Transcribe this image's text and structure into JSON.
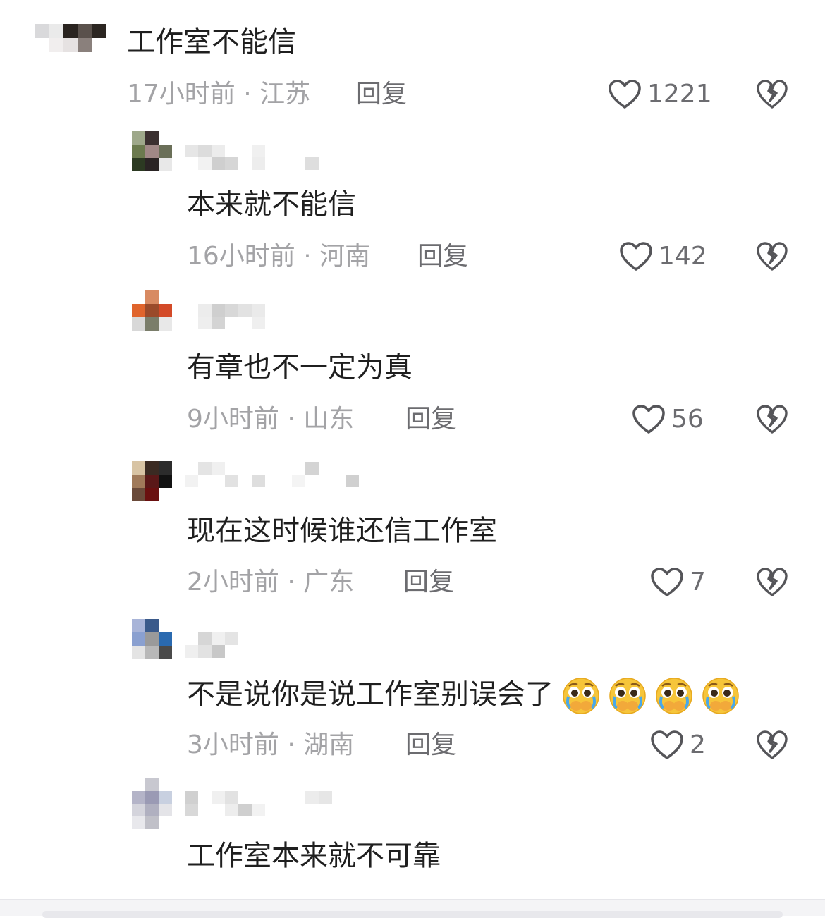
{
  "comments": [
    {
      "text": "工作室不能信",
      "time": "17小时前",
      "region": "江苏",
      "reply": "回复",
      "likes": "1221"
    },
    {
      "text": "本来就不能信",
      "time": "16小时前",
      "region": "河南",
      "reply": "回复",
      "likes": "142"
    },
    {
      "text": "有章也不一定为真",
      "time": "9小时前",
      "region": "山东",
      "reply": "回复",
      "likes": "56"
    },
    {
      "text": "现在这时候谁还信工作室",
      "time": "2小时前",
      "region": "广东",
      "reply": "回复",
      "likes": "7"
    },
    {
      "text": "不是说你是说工作室别误会了",
      "time": "3小时前",
      "region": "湖南",
      "reply": "回复",
      "likes": "2",
      "emoji": [
        "crying-face-emoji",
        "crying-face-emoji",
        "crying-face-emoji",
        "crying-face-emoji"
      ]
    },
    {
      "text": "工作室本来就不可靠"
    }
  ],
  "separator": "·",
  "icons": {
    "like": "heart-outline-icon",
    "dislike": "broken-heart-icon"
  },
  "colors": {
    "text": "#1f1f1f",
    "meta": "#a3a3a6",
    "reply": "#6c6c70"
  }
}
